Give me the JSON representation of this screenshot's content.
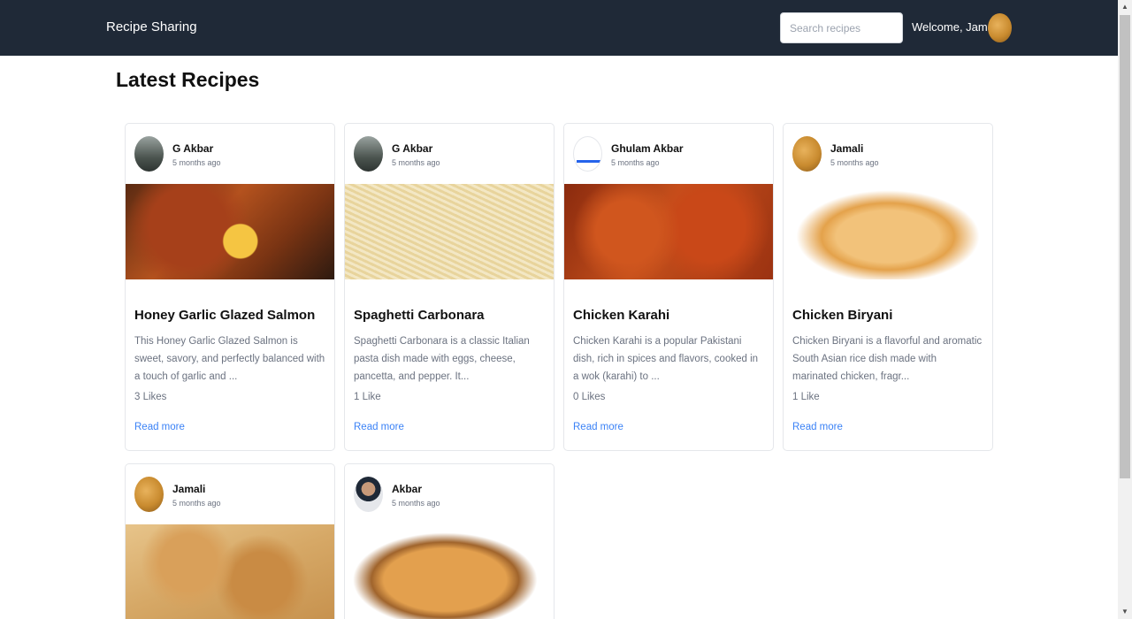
{
  "navbar": {
    "brand": "Recipe Sharing",
    "search_placeholder": "Search recipes",
    "welcome": "Welcome, Jamali"
  },
  "main": {
    "title": "Latest Recipes",
    "read_more_label": "Read more",
    "cards": [
      {
        "author": "G Akbar",
        "time": "5 months ago",
        "title": "Honey Garlic Glazed Salmon",
        "description": "This Honey Garlic Glazed Salmon is sweet, savory, and perfectly balanced with a touch of garlic and ...",
        "likes": "3 Likes",
        "read_more": "Read more"
      },
      {
        "author": "G Akbar",
        "time": "5 months ago",
        "title": "Spaghetti Carbonara",
        "description": "Spaghetti Carbonara is a classic Italian pasta dish made with eggs, cheese, pancetta, and pepper. It...",
        "likes": "1 Like",
        "read_more": "Read more"
      },
      {
        "author": "Ghulam Akbar",
        "time": "5 months ago",
        "title": "Chicken Karahi",
        "description": "Chicken Karahi is a popular Pakistani dish, rich in spices and flavors, cooked in a wok (karahi) to ...",
        "likes": "0 Likes",
        "read_more": "Read more"
      },
      {
        "author": "Jamali",
        "time": "5 months ago",
        "title": "Chicken Biryani",
        "description": "Chicken Biryani is a flavorful and aromatic South Asian rice dish made with marinated chicken, fragr...",
        "likes": "1 Like",
        "read_more": "Read more"
      },
      {
        "author": "Jamali",
        "time": "5 months ago"
      },
      {
        "author": "Akbar",
        "time": "5 months ago"
      }
    ]
  },
  "icons": {
    "scroll_up": "scroll-up-arrow-icon",
    "scroll_down": "scroll-down-arrow-icon"
  },
  "colors": {
    "navbar_bg": "#1f2937",
    "link": "#3b82f6",
    "muted_text": "#6b7280"
  }
}
